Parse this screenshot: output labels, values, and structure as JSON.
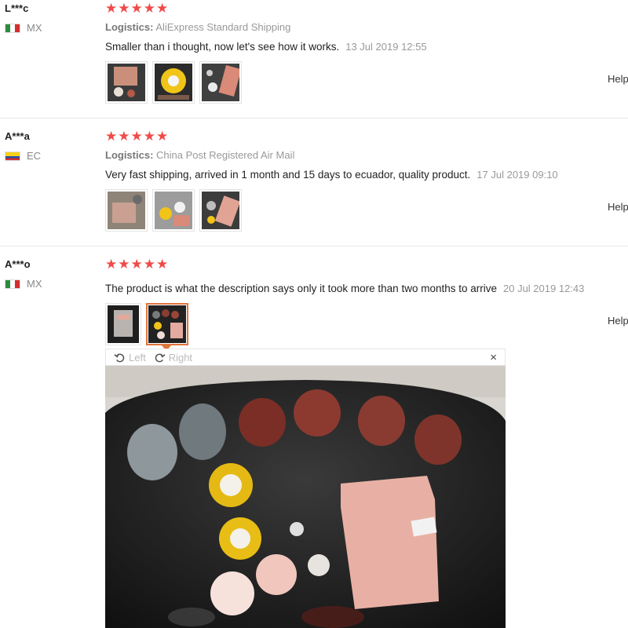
{
  "reviews": [
    {
      "user": "L***c",
      "country": "MX",
      "stars": "★★★★★",
      "logistics_label": "Logistics:",
      "logistics_value": "AliExpress Standard Shipping",
      "text": "Smaller than i thought, now let's see how it works.",
      "date": "13 Jul 2019 12:55",
      "help": "Help"
    },
    {
      "user": "A***a",
      "country": "EC",
      "stars": "★★★★★",
      "logistics_label": "Logistics:",
      "logistics_value": "China Post Registered Air Mail",
      "text": "Very fast shipping, arrived in 1 month and 15 days to ecuador, quality product.",
      "date": "17 Jul 2019 09:10",
      "help": "Help"
    },
    {
      "user": "A***o",
      "country": "MX",
      "stars": "★★★★★",
      "text": "The product is what the description says only it took more than two months to arrive",
      "date": "20 Jul 2019 12:43",
      "help": "Help"
    }
  ],
  "viewer": {
    "rotate_left": "Left",
    "rotate_right": "Right",
    "close": "×"
  },
  "colors": {
    "star": "#ef4a4a",
    "active_border": "#e0743a"
  }
}
